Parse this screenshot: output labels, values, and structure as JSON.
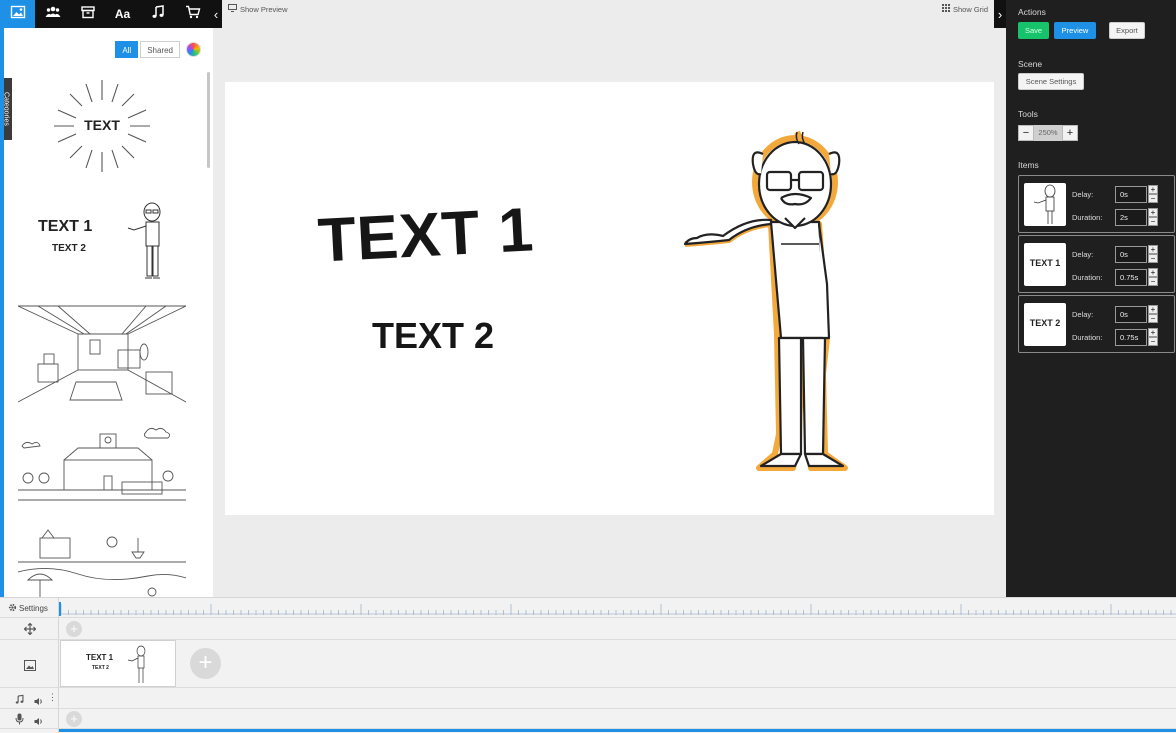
{
  "toolbar": {
    "icons": [
      "image-icon",
      "people-icon",
      "box-icon",
      "text-icon",
      "music-icon",
      "cart-icon"
    ],
    "text_icon_glyph": "Aa",
    "collapse_glyph": "‹",
    "accent": "#1e90e6"
  },
  "library": {
    "filters": {
      "all": "All",
      "shared": "Shared"
    },
    "categories_tab": "Categories",
    "assets": [
      {
        "kind": "text-burst",
        "text": "TEXT"
      },
      {
        "kind": "character-text",
        "text1": "TEXT 1",
        "text2": "TEXT 2"
      },
      {
        "kind": "room-scene"
      },
      {
        "kind": "school-scene"
      },
      {
        "kind": "beach-scene"
      }
    ]
  },
  "canvas": {
    "show_preview": "Show Preview",
    "show_grid": "Show Grid",
    "text1": "TEXT 1",
    "text2": "TEXT 2"
  },
  "panel": {
    "actions_title": "Actions",
    "save": "Save",
    "preview": "Preview",
    "export": "Export",
    "scene_title": "Scene",
    "scene_settings": "Scene Settings",
    "tools_title": "Tools",
    "zoom": "250%",
    "zoom_minus": "−",
    "zoom_plus": "+",
    "items_title": "Items",
    "items": [
      {
        "thumb": "character",
        "delay_label": "Delay:",
        "delay": "0s",
        "duration_label": "Duration:",
        "duration": "2s"
      },
      {
        "thumb": "TEXT 1",
        "delay_label": "Delay:",
        "delay": "0s",
        "duration_label": "Duration:",
        "duration": "0.75s"
      },
      {
        "thumb": "TEXT 2",
        "delay_label": "Delay:",
        "delay": "0s",
        "duration_label": "Duration:",
        "duration": "0.75s"
      }
    ],
    "colors": {
      "save": "#16c26a",
      "preview": "#1e90e6",
      "bg": "#1f1f1f"
    }
  },
  "timeline": {
    "settings": "Settings",
    "clip": {
      "text1": "TEXT 1",
      "text2": "TEXT 2"
    },
    "add_glyph": "+"
  }
}
